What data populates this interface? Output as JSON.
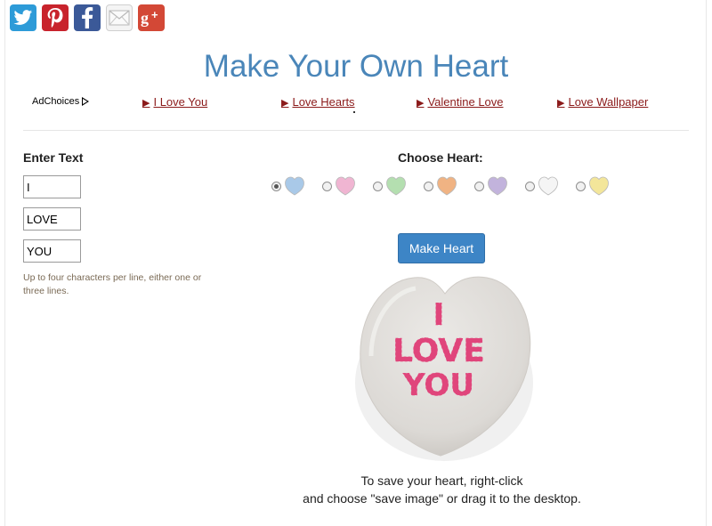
{
  "social": [
    {
      "name": "twitter",
      "icon": "twitter-bird-icon",
      "color": "#2d9bd8"
    },
    {
      "name": "pinterest",
      "icon": "pinterest-p-icon",
      "color": "#c8232c"
    },
    {
      "name": "facebook",
      "icon": "facebook-f-icon",
      "color": "#3b5998"
    },
    {
      "name": "email",
      "icon": "envelope-icon",
      "color": "#f4f4f4"
    },
    {
      "name": "google-plus",
      "icon": "google-plus-icon",
      "color": "#d34836"
    }
  ],
  "page": {
    "title": "Make Your Own Heart",
    "title_color": "#4a86b9"
  },
  "ads": {
    "adchoices_label": "AdChoices",
    "links": [
      {
        "label": "I Love You"
      },
      {
        "label": "Love Hearts"
      },
      {
        "label": "Valentine Love"
      },
      {
        "label": "Love Wallpaper"
      }
    ],
    "link_color": "#8b1a1a"
  },
  "form": {
    "enter_label": "Enter Text",
    "lines": [
      "I",
      "LOVE",
      "YOU"
    ],
    "hint": "Up to four characters per line, either one or three lines."
  },
  "choose": {
    "label": "Choose Heart:",
    "options": [
      {
        "color": "#a9c9e8",
        "checked": true
      },
      {
        "color": "#f0b5d2",
        "checked": false
      },
      {
        "color": "#b4dfb0",
        "checked": false
      },
      {
        "color": "#f0b383",
        "checked": false
      },
      {
        "color": "#c2b3dc",
        "checked": false
      },
      {
        "color": "#f5f5f5",
        "checked": false
      },
      {
        "color": "#f3e69a",
        "checked": false
      }
    ]
  },
  "button": {
    "make_label": "Make Heart",
    "color": "#3d85c6"
  },
  "heart": {
    "lines": [
      "I",
      "LOVE",
      "YOU"
    ],
    "fill": "#e3e1de",
    "text_color": "#e0457b"
  },
  "save": {
    "line1": "To save your heart, right-click",
    "line2": "and choose \"save image\" or drag it to the desktop."
  }
}
